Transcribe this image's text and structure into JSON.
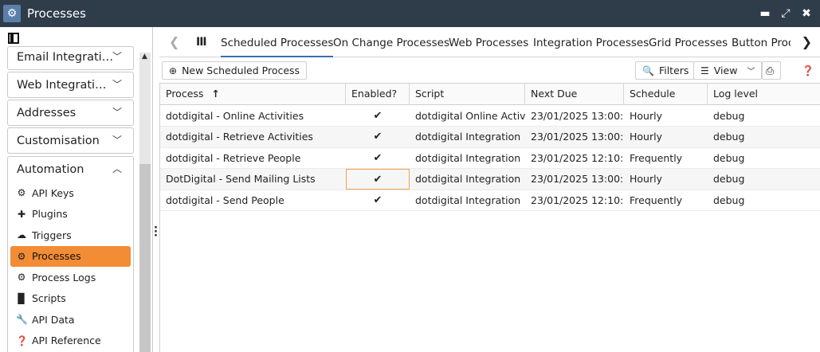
{
  "window": {
    "title": "Processes"
  },
  "sidebar": {
    "panels": [
      {
        "label": "Email Integrati…"
      },
      {
        "label": "Web Integrati…"
      },
      {
        "label": "Addresses"
      },
      {
        "label": "Customisation"
      },
      {
        "label": "Automation"
      }
    ],
    "automation_items": [
      {
        "label": "API Keys",
        "icon": "gear-icon"
      },
      {
        "label": "Plugins",
        "icon": "plug-icon"
      },
      {
        "label": "Triggers",
        "icon": "cloud-icon"
      },
      {
        "label": "Processes",
        "icon": "gear-icon",
        "active": true
      },
      {
        "label": "Process Logs",
        "icon": "gears-icon"
      },
      {
        "label": "Scripts",
        "icon": "file-icon"
      },
      {
        "label": "API Data",
        "icon": "wrench-icon"
      },
      {
        "label": "API Reference",
        "icon": "help-icon"
      }
    ]
  },
  "tabs": [
    {
      "label": "Scheduled Processes",
      "active": true
    },
    {
      "label": "On Change Processes"
    },
    {
      "label": "Web Processes"
    },
    {
      "label": "Integration Processes"
    },
    {
      "label": "Grid Processes"
    },
    {
      "label": "Button Proc"
    }
  ],
  "toolbar": {
    "new_label": "New Scheduled Process",
    "filters_label": "Filters",
    "view_label": "View"
  },
  "grid": {
    "columns": [
      "Process",
      "Enabled?",
      "Script",
      "Next Due",
      "Schedule",
      "Log level"
    ],
    "rows": [
      {
        "process": "dotdigital - Online Activities",
        "enabled": "✔",
        "script": "dotdigital Online Activ…",
        "next_due": "23/01/2025 13:00:…",
        "schedule": "Hourly",
        "log_level": "debug"
      },
      {
        "process": "dotdigital - Retrieve Activities",
        "enabled": "✔",
        "script": "dotdigital Integration",
        "next_due": "23/01/2025 13:00:…",
        "schedule": "Hourly",
        "log_level": "debug"
      },
      {
        "process": "dotdigital - Retrieve People",
        "enabled": "✔",
        "script": "dotdigital Integration",
        "next_due": "23/01/2025 12:10:…",
        "schedule": "Frequently",
        "log_level": "debug"
      },
      {
        "process": "DotDigital - Send Mailing Lists",
        "enabled": "✔",
        "script": "dotdigital Integration",
        "next_due": "23/01/2025 13:00:…",
        "schedule": "Hourly",
        "log_level": "debug"
      },
      {
        "process": "dotdigital - Send People",
        "enabled": "✔",
        "script": "dotdigital Integration",
        "next_due": "23/01/2025 12:10:…",
        "schedule": "Frequently",
        "log_level": "debug"
      }
    ]
  },
  "colors": {
    "accent_active": "#f28c35",
    "titlebar": "#2f3d4a",
    "tab_underline": "#3b6fa8"
  }
}
